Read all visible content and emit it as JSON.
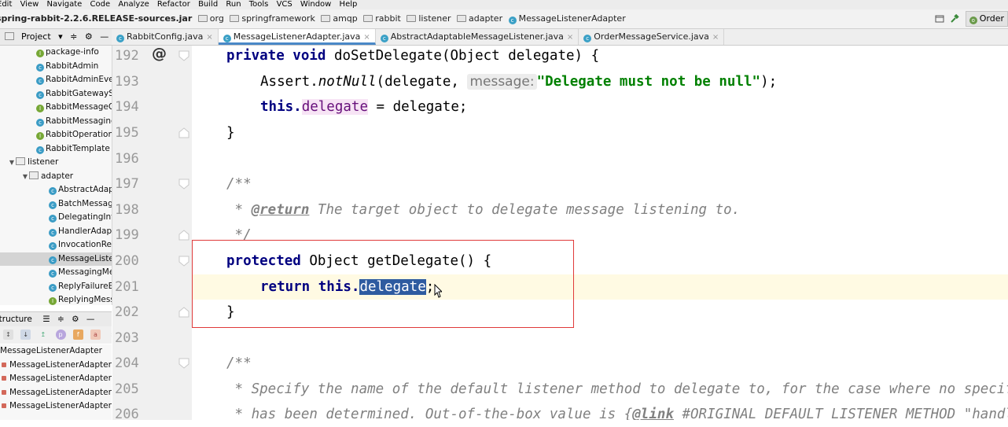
{
  "menu": [
    "Edit",
    "View",
    "Navigate",
    "Code",
    "Analyze",
    "Refactor",
    "Build",
    "Run",
    "Tools",
    "VCS",
    "Window",
    "Help"
  ],
  "breadcrumbs": {
    "jar": "spring-rabbit-2.2.6.RELEASE-sources.jar",
    "packages": [
      "org",
      "springframework",
      "amqp",
      "rabbit",
      "listener",
      "adapter"
    ],
    "class": "MessageListenerAdapter"
  },
  "run_config": "Order",
  "project_panel": {
    "title": "Project"
  },
  "tree": [
    {
      "label": "package-info",
      "kind": "interface",
      "indent": 1
    },
    {
      "label": "RabbitAdmin",
      "kind": "class",
      "indent": 1
    },
    {
      "label": "RabbitAdminEvent",
      "kind": "class",
      "indent": 1
    },
    {
      "label": "RabbitGatewaySupport",
      "kind": "class",
      "indent": 1
    },
    {
      "label": "RabbitMessageOperations",
      "kind": "interface",
      "indent": 1
    },
    {
      "label": "RabbitMessagingTemplate",
      "kind": "class",
      "indent": 1
    },
    {
      "label": "RabbitOperations",
      "kind": "interface",
      "indent": 1
    },
    {
      "label": "RabbitTemplate",
      "kind": "class",
      "indent": 1
    },
    {
      "label": "listener",
      "kind": "package",
      "indent": 0
    },
    {
      "label": "adapter",
      "kind": "package",
      "indent": 1
    },
    {
      "label": "AbstractAdaptableMessageListener",
      "kind": "class",
      "indent": 2
    },
    {
      "label": "BatchMessagingMessageListenerAdapter",
      "kind": "class",
      "indent": 2
    },
    {
      "label": "DelegatingInvocableHandler",
      "kind": "class",
      "indent": 2
    },
    {
      "label": "HandlerAdapter",
      "kind": "class",
      "indent": 2
    },
    {
      "label": "InvocationResult",
      "kind": "class",
      "indent": 2
    },
    {
      "label": "MessageListenerAdapter",
      "kind": "class",
      "indent": 2,
      "selected": true
    },
    {
      "label": "MessagingMessageListenerAdapter",
      "kind": "class",
      "indent": 2
    },
    {
      "label": "ReplyFailureException",
      "kind": "class",
      "indent": 2
    },
    {
      "label": "ReplyingMessageListener",
      "kind": "interface",
      "indent": 2
    }
  ],
  "structure_panel": {
    "title": "Structure",
    "root": "MessageListenerAdapter",
    "items": [
      "MessageListenerAdapter()",
      "MessageListenerAdapter(Object)",
      "MessageListenerAdapter(Object, MessageConverter)",
      "MessageListenerAdapter(Object, String)"
    ]
  },
  "tabs": [
    {
      "label": "RabbitConfig.java",
      "active": false
    },
    {
      "label": "MessageListenerAdapter.java",
      "active": true
    },
    {
      "label": "AbstractAdaptableMessageListener.java",
      "active": false
    },
    {
      "label": "OrderMessageService.java",
      "active": false
    }
  ],
  "code": {
    "line_numbers": [
      "192",
      "193",
      "194",
      "195",
      "196",
      "197",
      "198",
      "199",
      "200",
      "201",
      "202",
      "203",
      "204",
      "205",
      "206"
    ],
    "override_marker": "@",
    "l192": {
      "kw": "private void",
      "rest": " doSetDelegate(Object delegate) {"
    },
    "l193": {
      "pre": "Assert.",
      "method": "notNull",
      "mid": "(delegate, ",
      "hint": "message:",
      "str": "\"Delegate must not be null\"",
      "end": ");"
    },
    "l194": {
      "kw": "this.",
      "field": "delegate",
      "rest": " = delegate;"
    },
    "l195": "}",
    "l197": "/**",
    "l198": {
      "star": " * ",
      "tag": "@return",
      "text": " The target object to delegate message listening to."
    },
    "l199": " */",
    "l200": {
      "kw": "protected",
      "rest": " Object getDelegate() {"
    },
    "l201": {
      "kw": "return this.",
      "sel": "delegate",
      "end": ";"
    },
    "l202": "}",
    "l204": "/**",
    "l205": " * Specify the name of the default listener method to delegate to, for the case where no specific listener method",
    "l206": {
      "pre": " * has been determined. Out-of-the-box value is {",
      "tag": "@link",
      "post": " #ORIGINAL_DEFAULT_LISTENER_METHOD \"handleMessage\"}."
    }
  },
  "colors": {
    "keyword": "#000080",
    "string": "#008000",
    "field": "#660e7a",
    "comment": "#808080",
    "selection": "#2e5ba0",
    "highlight_box": "#e03a3a"
  }
}
